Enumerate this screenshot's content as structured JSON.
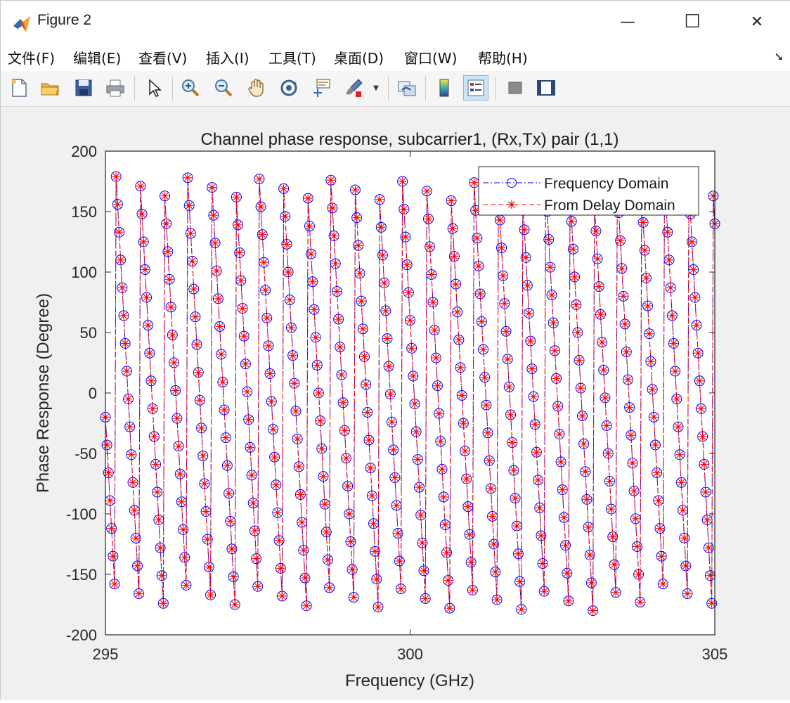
{
  "window": {
    "title": "Figure 2",
    "controls": {
      "minimize": "—",
      "maximize": "☐",
      "close": "✕"
    }
  },
  "menubar": {
    "items": [
      "文件(F)",
      "编辑(E)",
      "查看(V)",
      "插入(I)",
      "工具(T)",
      "桌面(D)",
      "窗口(W)",
      "帮助(H)"
    ],
    "overflow_icon": "arrow-icon"
  },
  "toolbar": {
    "buttons": [
      {
        "name": "new-figure",
        "icon": "new-file-icon"
      },
      {
        "name": "open",
        "icon": "folder-icon"
      },
      {
        "name": "save",
        "icon": "save-icon"
      },
      {
        "name": "print",
        "icon": "printer-icon"
      },
      {
        "name": "edit-plot",
        "icon": "pointer-icon"
      },
      {
        "name": "zoom-in",
        "icon": "zoom-in-icon"
      },
      {
        "name": "zoom-out",
        "icon": "zoom-out-icon"
      },
      {
        "name": "pan",
        "icon": "hand-icon"
      },
      {
        "name": "rotate-3d",
        "icon": "rotate-icon"
      },
      {
        "name": "data-cursor",
        "icon": "data-tip-icon"
      },
      {
        "name": "brush",
        "icon": "brush-icon"
      },
      {
        "name": "link-plot",
        "icon": "link-icon"
      },
      {
        "name": "colorbar",
        "icon": "colorbar-icon"
      },
      {
        "name": "legend",
        "icon": "legend-icon"
      },
      {
        "name": "hide-plot-tools",
        "icon": "hide-icon"
      },
      {
        "name": "show-plot-tools",
        "icon": "show-icon"
      }
    ],
    "colors": {
      "brush": "#e02020",
      "active_bg": "#cfe3f7"
    }
  },
  "chart_data": {
    "type": "line",
    "title": "Channel phase response, subcarrier1, (Rx,Tx) pair (1,1)",
    "xlabel": "Frequency (GHz)",
    "ylabel": "Phase Response (Degree)",
    "xlim": [
      295,
      305
    ],
    "ylim": [
      -200,
      200
    ],
    "xticks": [
      "295",
      "300",
      "305"
    ],
    "yticks": [
      "200",
      "150",
      "100",
      "50",
      "0",
      "-50",
      "-100",
      "-150",
      "-200"
    ],
    "grid": false,
    "legend_position": "top-right",
    "model": {
      "description_note": "phase wraps linearly in frequency; samples every 0.025 GHz",
      "f_start": 295.0,
      "f_end": 305.0,
      "step": 0.025,
      "slope_deg_per_ghz": -920,
      "phase_at_start": -20
    },
    "series": [
      {
        "name": "Frequency Domain",
        "color": "#0000ff",
        "marker": "circle",
        "line": "dash-dot"
      },
      {
        "name": "From Delay Domain",
        "color": "#ff0000",
        "marker": "asterisk",
        "line": "dashed"
      }
    ]
  }
}
